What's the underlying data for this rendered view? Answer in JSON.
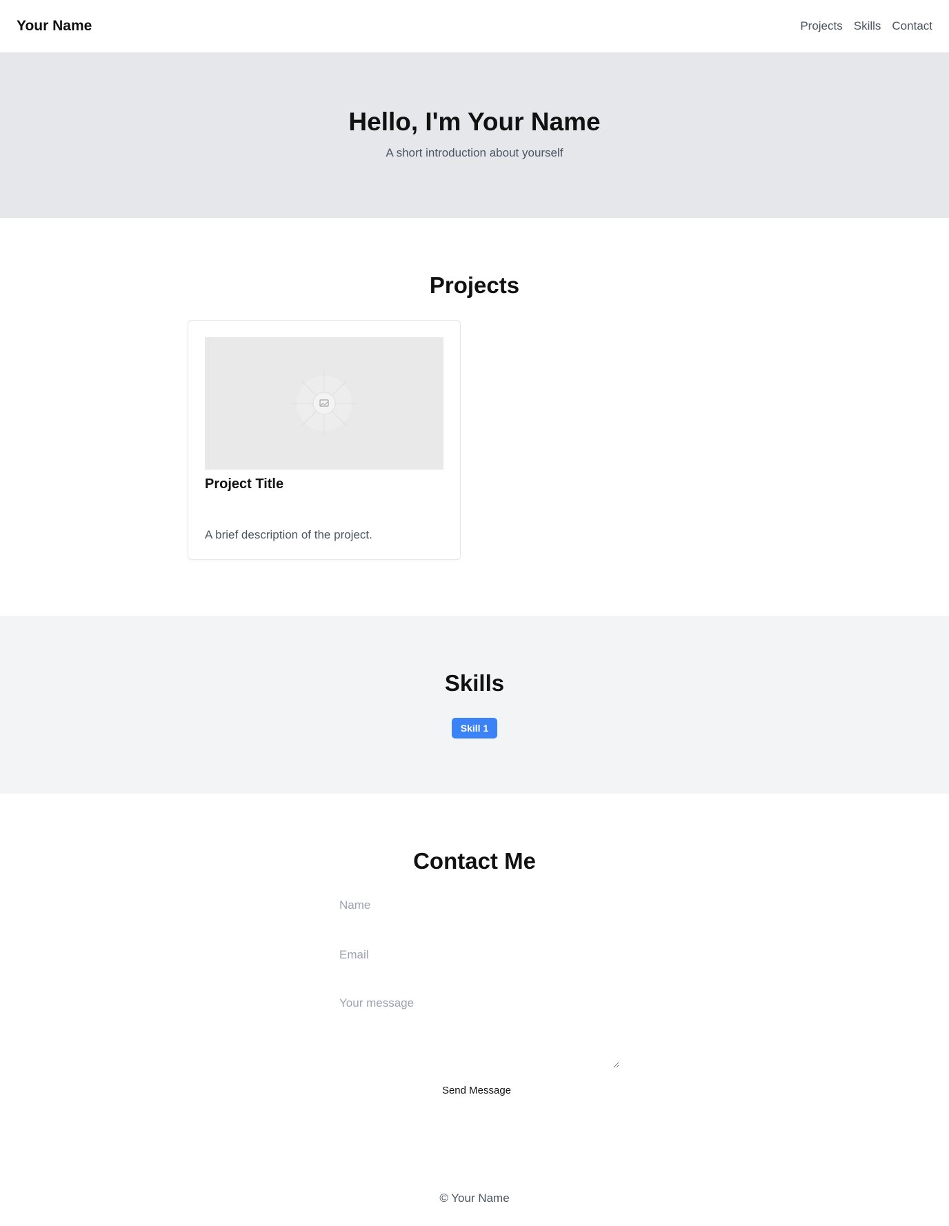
{
  "header": {
    "brand": "Your Name",
    "nav": [
      "Projects",
      "Skills",
      "Contact"
    ]
  },
  "hero": {
    "title": "Hello, I'm Your Name",
    "subtitle": "A short introduction about yourself"
  },
  "projects": {
    "title": "Projects",
    "items": [
      {
        "image_icon": "image-placeholder-icon",
        "title": "Project Title",
        "description": "A brief description of the project."
      }
    ]
  },
  "skills": {
    "title": "Skills",
    "items": [
      "Skill 1"
    ],
    "badge_color": "#3b82f6"
  },
  "contact": {
    "title": "Contact Me",
    "name_placeholder": "Name",
    "email_placeholder": "Email",
    "message_placeholder": "Your message",
    "submit_label": "Send Message"
  },
  "footer": {
    "text": "© Your Name"
  },
  "colors": {
    "hero_bg": "#e5e7eb",
    "skills_bg": "#f3f4f6",
    "muted_text": "#4b5563",
    "accent": "#3b82f6"
  }
}
